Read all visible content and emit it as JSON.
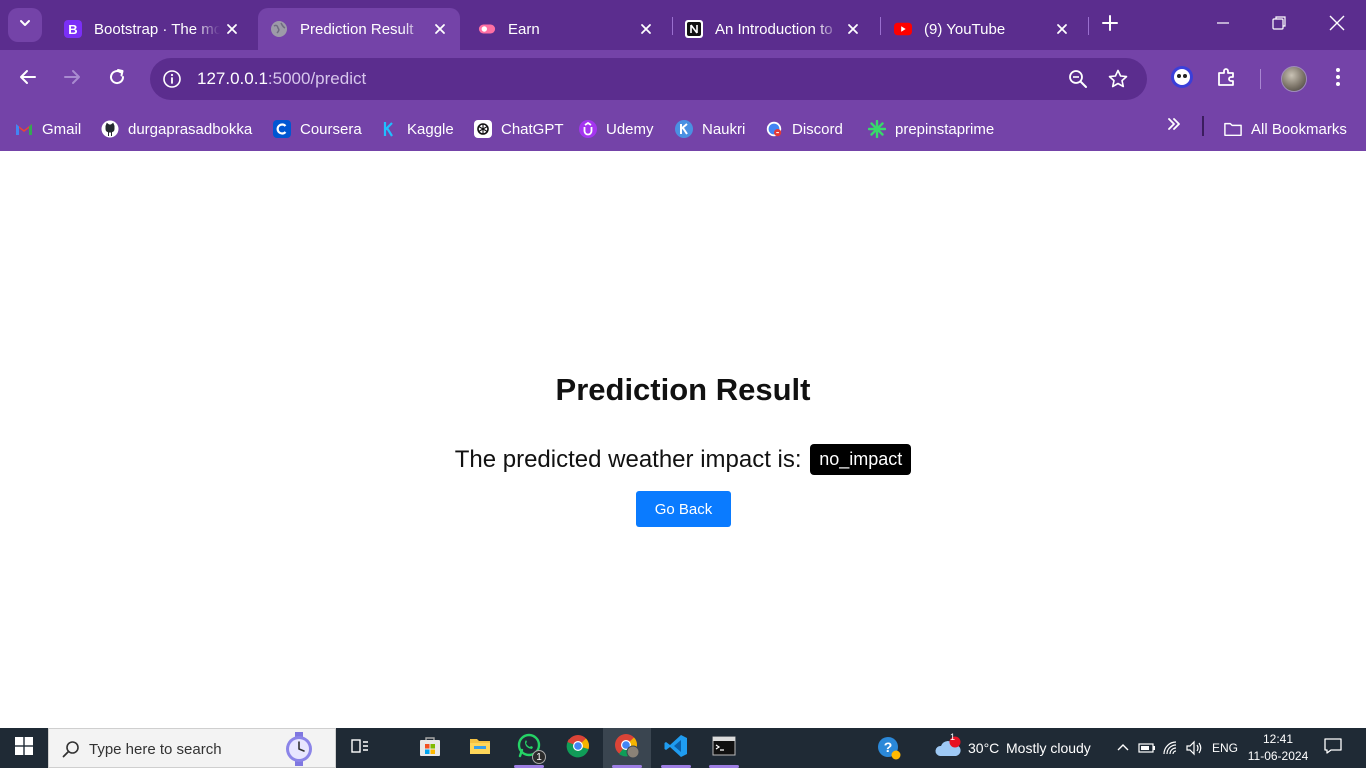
{
  "browser": {
    "tabs": [
      {
        "title": "Bootstrap · The most popular HTML, CSS, and JS library",
        "icon": "bootstrap-icon"
      },
      {
        "title": "Prediction Result",
        "icon": "globe-icon",
        "active": true
      },
      {
        "title": "Earn",
        "icon": "earn-icon"
      },
      {
        "title": "An Introduction to",
        "icon": "notion-icon"
      },
      {
        "title": "(9) YouTube",
        "icon": "youtube-icon"
      }
    ],
    "address": {
      "host": "127.0.0.1",
      "path": ":5000/predict"
    },
    "bookmarks": [
      {
        "label": "Gmail",
        "icon": "gmail-icon"
      },
      {
        "label": "durgaprasadbokka",
        "icon": "github-icon"
      },
      {
        "label": "Coursera",
        "icon": "coursera-icon"
      },
      {
        "label": "Kaggle",
        "icon": "kaggle-icon"
      },
      {
        "label": "ChatGPT",
        "icon": "chatgpt-icon"
      },
      {
        "label": "Udemy",
        "icon": "udemy-icon"
      },
      {
        "label": "Naukri",
        "icon": "naukri-icon"
      },
      {
        "label": "Discord",
        "icon": "discord-icon"
      },
      {
        "label": "prepinstaprime",
        "icon": "prepinsta-icon"
      }
    ],
    "all_bookmarks_label": "All Bookmarks",
    "theme_colors": {
      "frame": "#5b2d8e",
      "toolbar": "#7443a8"
    }
  },
  "page": {
    "title": "Prediction Result",
    "result_prefix": "The predicted weather impact is:",
    "result_value": "no_impact",
    "back_button": "Go Back",
    "button_color": "#0a7bff"
  },
  "taskbar": {
    "search_placeholder": "Type here to search",
    "whatsapp_badge": "1",
    "weather_badge": "1",
    "weather_temp": "30°C",
    "weather_text": "Mostly cloudy",
    "language": "ENG",
    "time": "12:41",
    "date": "11-06-2024"
  }
}
